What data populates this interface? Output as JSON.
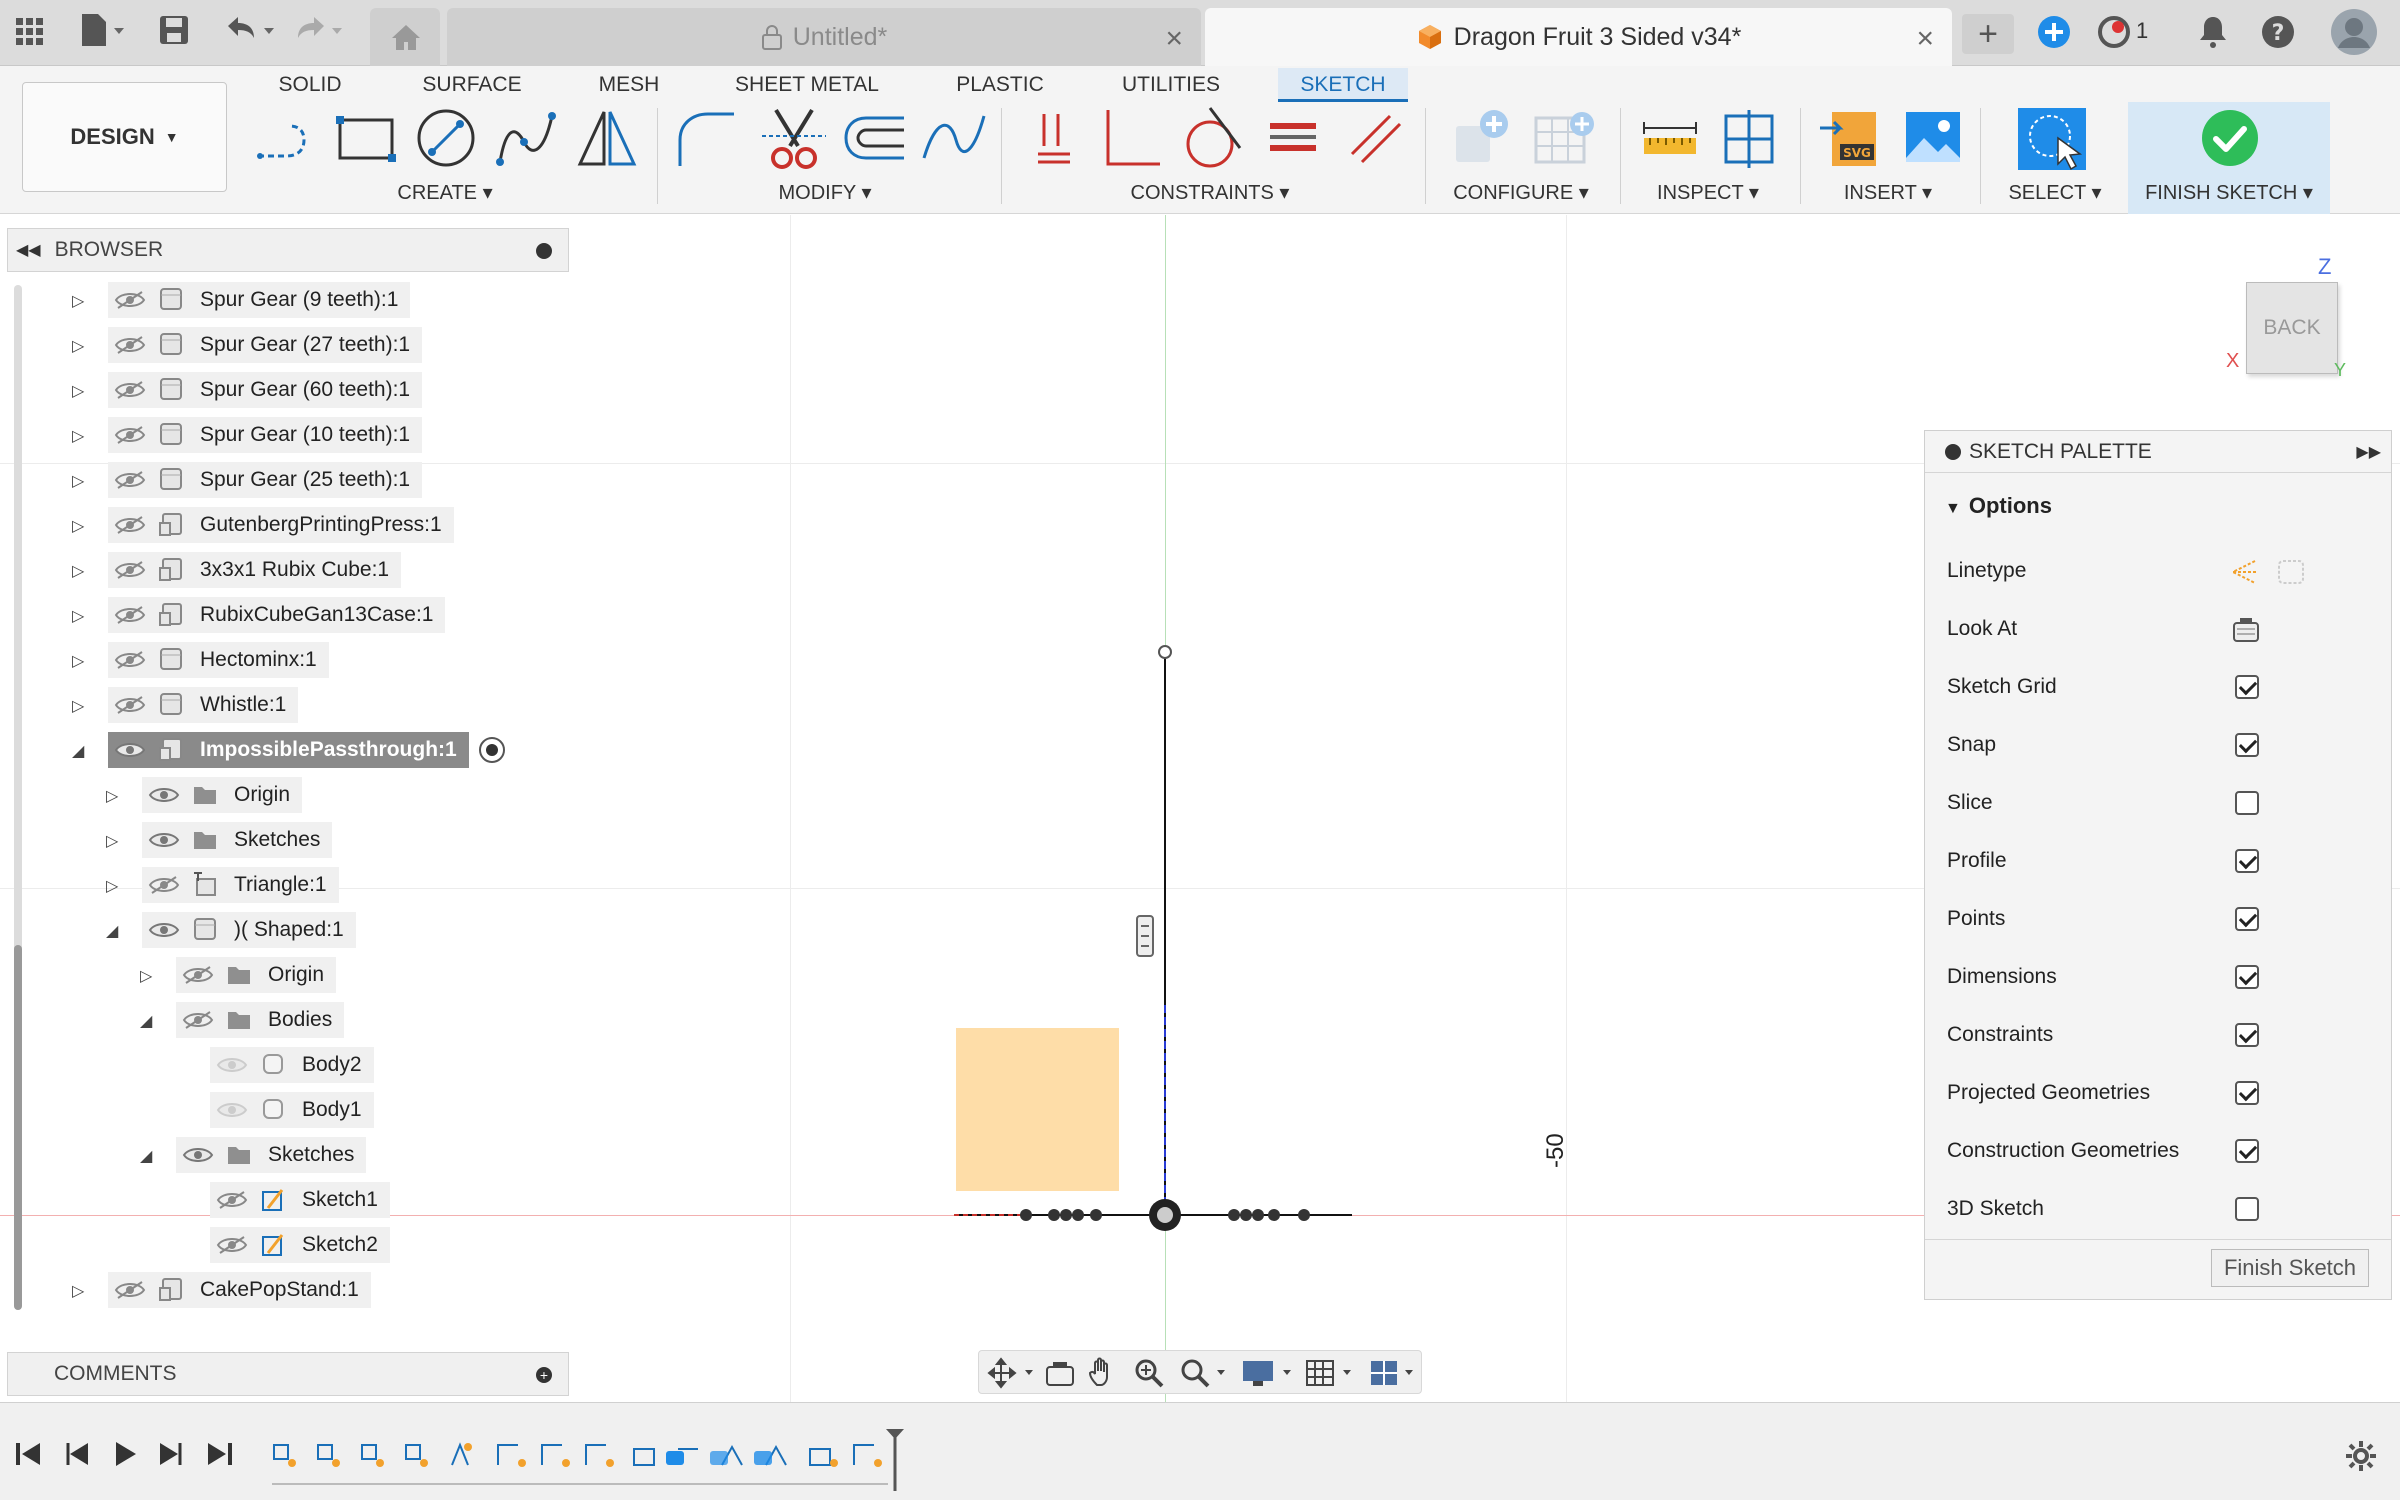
{
  "titlebar": {
    "tab_untitled": "Untitled*",
    "tab_active": "Dragon Fruit 3 Sided v34*",
    "jobs_count": "1"
  },
  "ribbon": {
    "workspace": "DESIGN",
    "tabs": [
      "SOLID",
      "SURFACE",
      "MESH",
      "SHEET METAL",
      "PLASTIC",
      "UTILITIES",
      "SKETCH"
    ],
    "groups": {
      "create": "CREATE",
      "modify": "MODIFY",
      "constraints": "CONSTRAINTS",
      "configure": "CONFIGURE",
      "inspect": "INSPECT",
      "insert": "INSERT",
      "select": "SELECT",
      "finish": "FINISH SKETCH"
    }
  },
  "browser": {
    "title": "BROWSER",
    "items": [
      "Spur Gear (9 teeth):1",
      "Spur Gear (27 teeth):1",
      "Spur Gear (60 teeth):1",
      "Spur Gear (10 teeth):1",
      "Spur Gear (25 teeth):1",
      "GutenbergPrintingPress:1",
      "3x3x1 Rubix Cube:1",
      "RubixCubeGan13Case:1",
      "Hectominx:1",
      "Whistle:1",
      "ImpossiblePassthrough:1",
      "Origin",
      "Sketches",
      "Triangle:1",
      ")( Shaped:1",
      "Origin",
      "Bodies",
      "Body2",
      "Body1",
      "Sketches",
      "Sketch1",
      "Sketch2",
      "CakePopStand:1"
    ]
  },
  "comments": {
    "title": "COMMENTS"
  },
  "viewcube": {
    "face": "BACK",
    "axis_z": "Z",
    "axis_x": "X",
    "axis_y": "Y"
  },
  "canvas": {
    "dimension_label": "-50"
  },
  "palette": {
    "title": "SKETCH PALETTE",
    "section": "Options",
    "rows": [
      {
        "label": "Linetype"
      },
      {
        "label": "Look At"
      },
      {
        "label": "Sketch Grid",
        "checked": true
      },
      {
        "label": "Snap",
        "checked": true
      },
      {
        "label": "Slice",
        "checked": false
      },
      {
        "label": "Profile",
        "checked": true
      },
      {
        "label": "Points",
        "checked": true
      },
      {
        "label": "Dimensions",
        "checked": true
      },
      {
        "label": "Constraints",
        "checked": true
      },
      {
        "label": "Projected Geometries",
        "checked": true
      },
      {
        "label": "Construction Geometries",
        "checked": true
      },
      {
        "label": "3D Sketch",
        "checked": false
      }
    ],
    "finish_button": "Finish Sketch"
  },
  "colors": {
    "accent": "#1a6fb8",
    "finish_green": "#2ebd59",
    "profile_fill": "#fedda8"
  }
}
